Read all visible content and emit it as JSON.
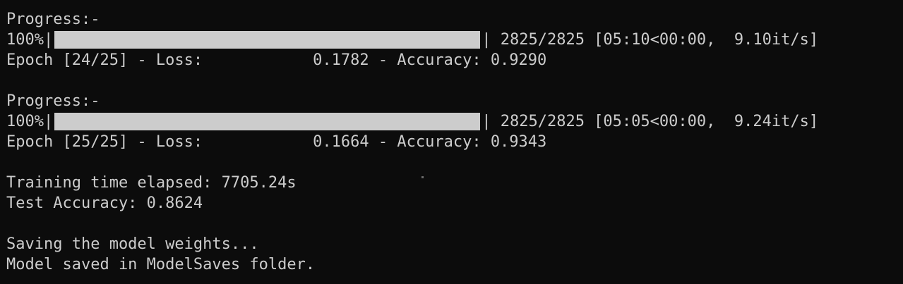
{
  "terminal": {
    "epochs": [
      {
        "progress_label": "Progress:-",
        "percent_text": "100%",
        "progress_fraction": 1.0,
        "stats_text": "2825/2825 [05:10<00:00,  9.10it/s]",
        "epoch_text": "Epoch [24/25] - Loss:",
        "loss_text": "0.1782 - Accuracy: 0.9290"
      },
      {
        "progress_label": "Progress:-",
        "percent_text": "100%",
        "progress_fraction": 1.0,
        "stats_text": "2825/2825 [05:05<00:00,  9.24it/s]",
        "epoch_text": "Epoch [25/25] - Loss:",
        "loss_text": "0.1664 - Accuracy: 0.9343"
      }
    ],
    "elapsed_text": "Training time elapsed: 7705.24s",
    "test_accuracy_text": "Test Accuracy: 0.8624",
    "saving_text": "Saving the model weights...",
    "saved_text": "Model saved in ModelSaves folder.",
    "bar_edge_char": "|",
    "colors": {
      "background": "#0c0c0c",
      "foreground": "#cccccc",
      "bar_fill": "#cccccc"
    }
  }
}
